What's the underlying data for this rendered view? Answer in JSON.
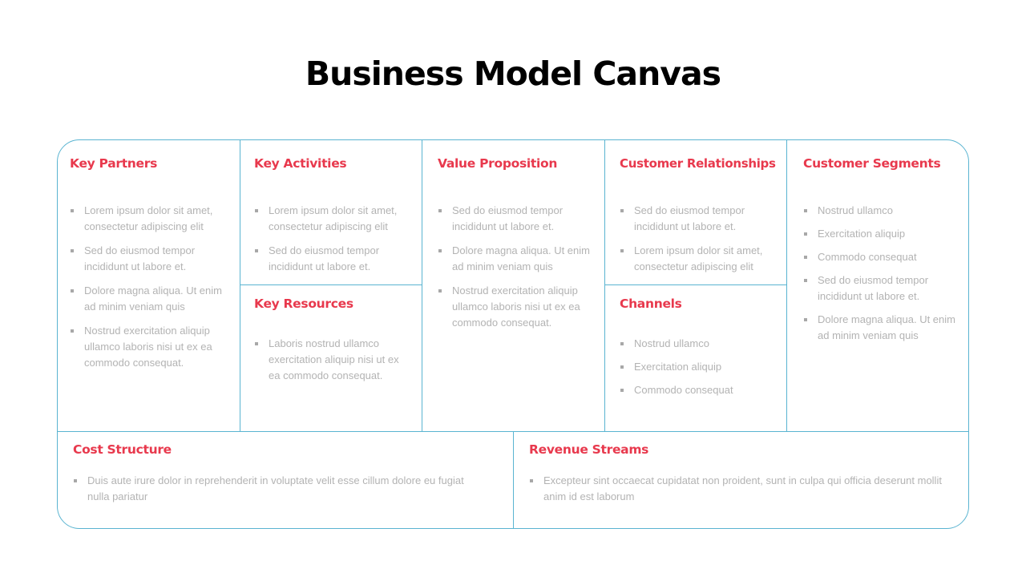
{
  "title": "Business Model Canvas",
  "colors": {
    "heading": "#e8394d",
    "border": "#5ab4d1",
    "body_text": "#b3b3b3",
    "title": "#000000"
  },
  "sections": {
    "key_partners": {
      "heading": "Key Partners",
      "items": [
        "Lorem ipsum dolor sit amet, consectetur adipiscing elit",
        "Sed do eiusmod tempor incididunt ut labore et.",
        "Dolore magna aliqua. Ut enim ad minim veniam quis",
        "Nostrud exercitation aliquip ullamco laboris nisi ut ex ea commodo consequat."
      ]
    },
    "key_activities": {
      "heading": "Key Activities",
      "items": [
        "Lorem ipsum dolor sit amet, consectetur adipiscing elit",
        "Sed do eiusmod tempor incididunt ut labore et."
      ]
    },
    "key_resources": {
      "heading": "Key Resources",
      "items": [
        "Laboris nostrud ullamco exercitation aliquip nisi ut ex ea commodo consequat."
      ]
    },
    "value_proposition": {
      "heading": "Value Proposition",
      "items": [
        "Sed do eiusmod tempor incididunt ut labore et.",
        "Dolore magna aliqua. Ut enim ad minim veniam quis",
        "Nostrud exercitation aliquip ullamco laboris nisi ut ex ea commodo consequat."
      ]
    },
    "customer_relationships": {
      "heading": "Customer Relationships",
      "items": [
        "Sed do eiusmod tempor incididunt ut labore et.",
        "Lorem ipsum dolor sit amet, consectetur adipiscing elit"
      ]
    },
    "channels": {
      "heading": "Channels",
      "items": [
        "Nostrud ullamco",
        "Exercitation aliquip",
        "Commodo consequat"
      ]
    },
    "customer_segments": {
      "heading": "Customer Segments",
      "items": [
        "Nostrud ullamco",
        "Exercitation aliquip",
        "Commodo consequat",
        "Sed do eiusmod tempor incididunt ut labore et.",
        "Dolore magna aliqua. Ut enim ad minim veniam quis"
      ]
    },
    "cost_structure": {
      "heading": "Cost Structure",
      "items": [
        "Duis aute irure dolor in reprehenderit in voluptate velit esse cillum dolore eu fugiat nulla pariatur"
      ]
    },
    "revenue_streams": {
      "heading": "Revenue Streams",
      "items": [
        "Excepteur sint occaecat cupidatat non proident, sunt in culpa qui officia deserunt mollit anim id est laborum"
      ]
    }
  }
}
